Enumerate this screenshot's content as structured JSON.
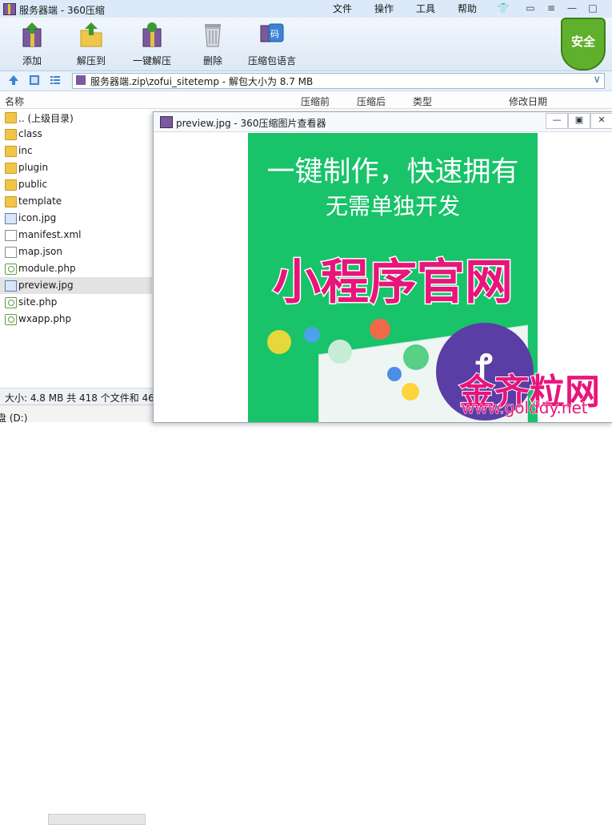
{
  "window": {
    "title": "服务器端 - 360压缩"
  },
  "menu": [
    "文件",
    "操作",
    "工具",
    "帮助"
  ],
  "toolbar": [
    {
      "label": "添加",
      "icon": "add-archive-icon"
    },
    {
      "label": "解压到",
      "icon": "extract-to-icon"
    },
    {
      "label": "一键解压",
      "icon": "one-click-extract-icon"
    },
    {
      "label": "删除",
      "icon": "delete-icon"
    },
    {
      "label": "压缩包语言",
      "icon": "archive-language-icon"
    }
  ],
  "security_badge": "安全",
  "address": {
    "path": "服务器端.zip\\zofui_sitetemp - 解包大小为 8.7 MB"
  },
  "columns": [
    "名称",
    "压缩前",
    "压缩后",
    "类型",
    "修改日期"
  ],
  "files": [
    {
      "name": ".. (上级目录)",
      "kind": "folder"
    },
    {
      "name": "class",
      "kind": "folder"
    },
    {
      "name": "inc",
      "kind": "folder"
    },
    {
      "name": "plugin",
      "kind": "folder"
    },
    {
      "name": "public",
      "kind": "folder"
    },
    {
      "name": "template",
      "kind": "folder"
    },
    {
      "name": "icon.jpg",
      "kind": "image"
    },
    {
      "name": "manifest.xml",
      "kind": "file"
    },
    {
      "name": "map.json",
      "kind": "file"
    },
    {
      "name": "module.php",
      "kind": "php"
    },
    {
      "name": "preview.jpg",
      "kind": "image",
      "selected": true
    },
    {
      "name": "site.php",
      "kind": "php"
    },
    {
      "name": "wxapp.php",
      "kind": "php"
    }
  ],
  "status": {
    "text": "大小: 4.8 MB 共 418 个文件和 46"
  },
  "bottom": {
    "drive": "盘 (D:)"
  },
  "viewer": {
    "title": "preview.jpg - 360压缩图片查看器",
    "poster": {
      "line1": "一键制作，快速拥有",
      "line2": "无需单独开发",
      "headline": "小程序官网"
    }
  },
  "watermark": {
    "brand": "金齐粒网",
    "url": "www.golddy.net"
  }
}
